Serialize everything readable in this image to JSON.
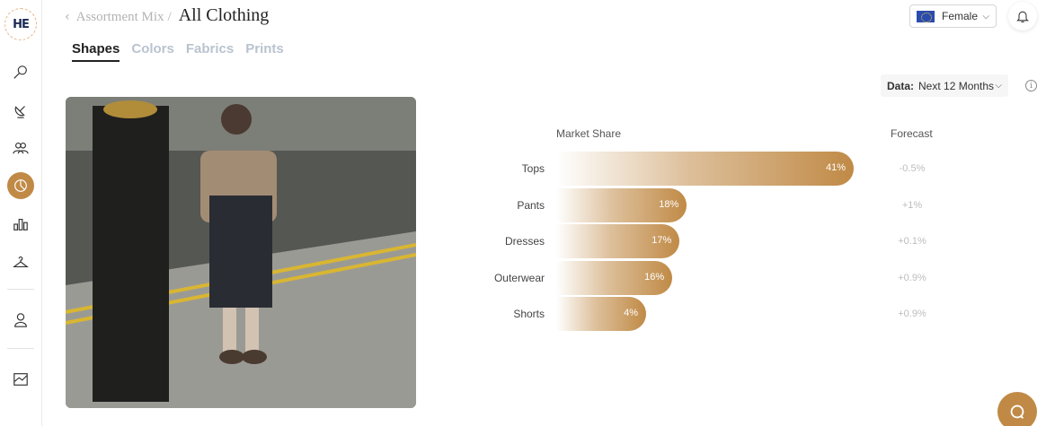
{
  "logo": {
    "text": "HE"
  },
  "breadcrumb": {
    "back": "‹",
    "parent": "Assortment Mix",
    "separator": "/",
    "current": "All Clothing"
  },
  "gender_select": {
    "value": "Female",
    "flag_icon": "eu-flag-icon"
  },
  "tabs": [
    {
      "label": "Shapes",
      "active": true
    },
    {
      "label": "Colors",
      "active": false
    },
    {
      "label": "Fabrics",
      "active": false
    },
    {
      "label": "Prints",
      "active": false
    }
  ],
  "data_select": {
    "label": "Data:",
    "value": "Next 12 Months"
  },
  "chart_data": {
    "type": "bar",
    "headers": {
      "market_share": "Market Share",
      "forecast": "Forecast"
    },
    "categories": [
      "Tops",
      "Pants",
      "Dresses",
      "Outerwear",
      "Shorts"
    ],
    "values": [
      41,
      18,
      17,
      16,
      4
    ],
    "value_labels": [
      "41%",
      "18%",
      "17%",
      "16%",
      "4%"
    ],
    "forecast": [
      "-0.5%",
      "+1%",
      "+0.1%",
      "+0.9%",
      "+0.9%"
    ],
    "colors": {
      "bar": "#c08a46"
    }
  },
  "sidebar": {
    "icons": [
      "search-icon",
      "satellite-icon",
      "users-icon",
      "pie-chart-icon",
      "bar-chart-icon",
      "hanger-icon",
      "person-icon",
      "report-icon"
    ],
    "active": "pie-chart-icon"
  },
  "colors": {
    "accent": "#c08a46",
    "tab_inactive": "#b9c3cf"
  }
}
